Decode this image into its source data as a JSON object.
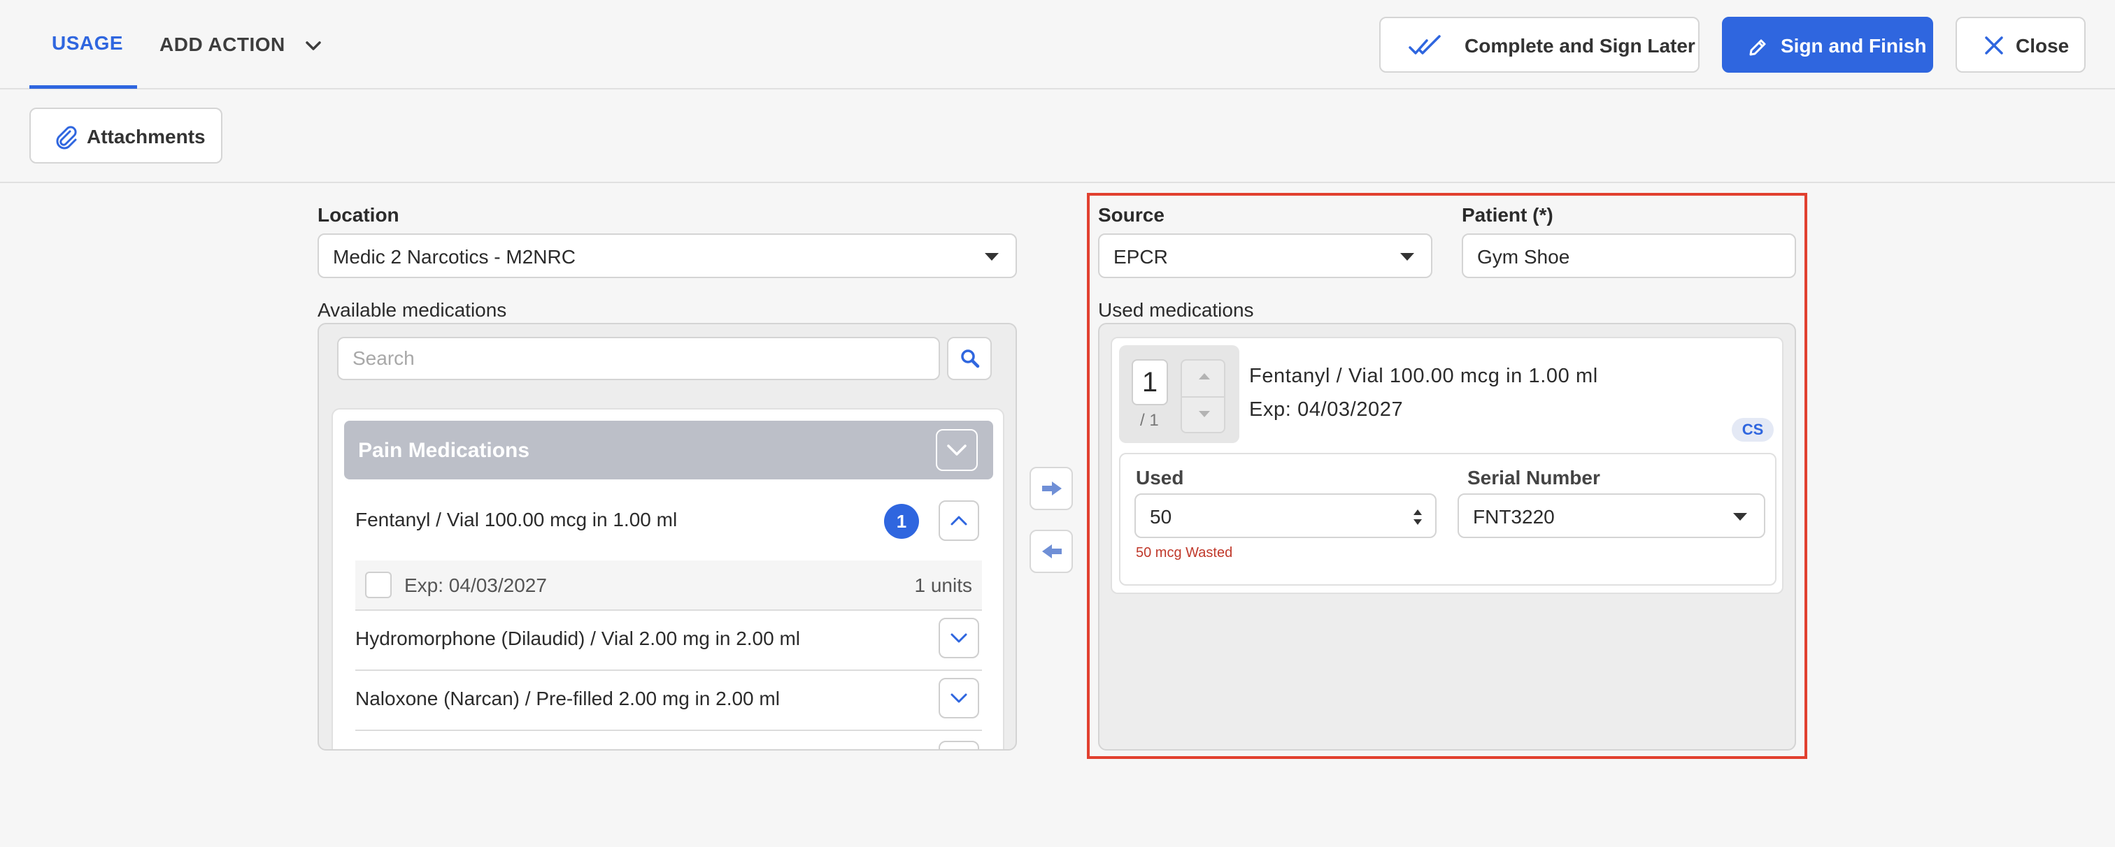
{
  "tabs": {
    "usage": "USAGE",
    "add_action": "ADD ACTION"
  },
  "header_buttons": {
    "complete_later": "Complete and Sign Later",
    "sign_finish": "Sign and Finish",
    "close": "Close"
  },
  "attachments_label": "Attachments",
  "location": {
    "label": "Location",
    "value": "Medic 2 Narcotics - M2NRC"
  },
  "available": {
    "label": "Available medications",
    "search_placeholder": "Search",
    "group_title": "Pain Medications",
    "items": [
      {
        "name": "Fentanyl / Vial 100.00 mcg in 1.00 ml",
        "count": "1",
        "lot_exp": "Exp: 04/03/2027",
        "lot_units": "1 units"
      },
      {
        "name": "Hydromorphone (Dilaudid) / Vial 2.00 mg in 2.00 ml"
      },
      {
        "name": "Naloxone (Narcan) / Pre-filled 2.00 mg in 2.00 ml"
      }
    ]
  },
  "source": {
    "label": "Source",
    "value": "EPCR"
  },
  "patient": {
    "label": "Patient (*)",
    "value": "Gym Shoe"
  },
  "used": {
    "label": "Used medications",
    "qty": "1",
    "qty_of": "/ 1",
    "name": "Fentanyl / Vial 100.00 mcg in 1.00 ml",
    "exp": "Exp: 04/03/2027",
    "badge": "CS",
    "used_label": "Used",
    "used_value": "50",
    "serial_label": "Serial Number",
    "serial_value": "FNT3220",
    "wasted": "50 mcg Wasted"
  },
  "colors": {
    "accent": "#2f66df",
    "highlight_border": "#e1402f",
    "wasted": "#c0392b"
  }
}
